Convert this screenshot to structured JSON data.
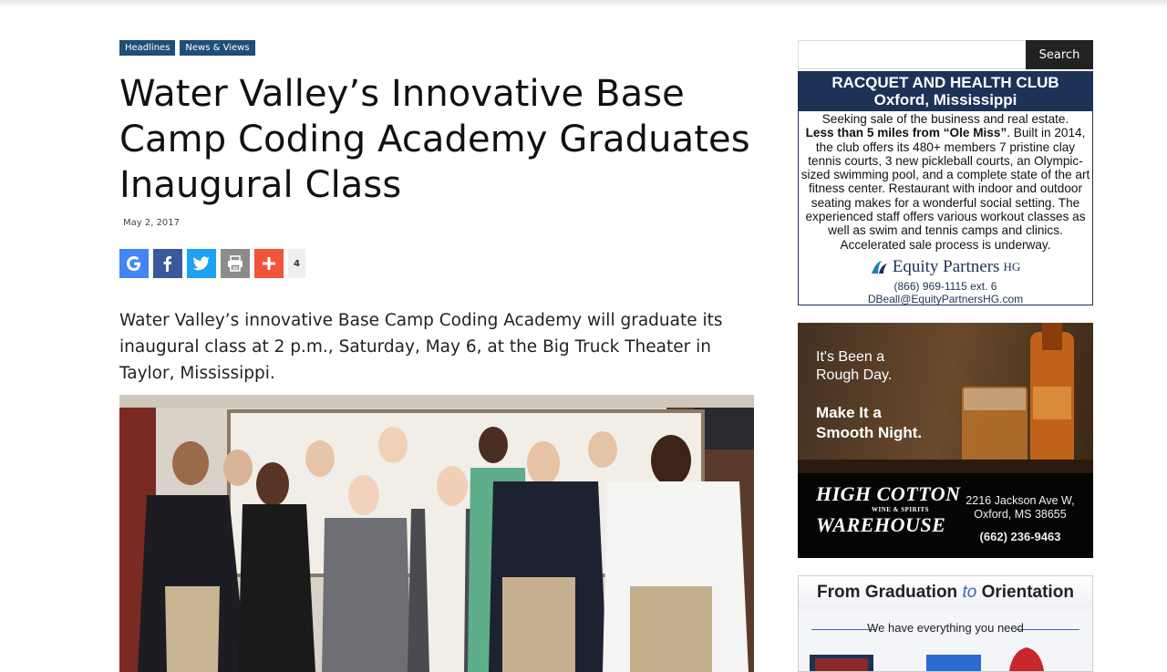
{
  "categories": [
    "Headlines",
    "News & Views"
  ],
  "article": {
    "title": "Water Valley’s Innovative Base Camp Coding Academy Graduates Inaugural Class",
    "date": "May 2, 2017",
    "share_count": "4",
    "lede": "Water Valley’s innovative Base Camp Coding Academy will graduate its inaugural class at 2 p.m., Saturday, May 6, at the Big Truck Theater in Taylor, Mississippi."
  },
  "share_buttons": [
    {
      "icon": "google-icon",
      "color": "#4285f4"
    },
    {
      "icon": "facebook-icon",
      "color": "#3b5998"
    },
    {
      "icon": "twitter-icon",
      "color": "#1da1f2"
    },
    {
      "icon": "print-icon",
      "color": "#8c8c8c"
    },
    {
      "icon": "plus-icon",
      "color": "#f0553b"
    }
  ],
  "search": {
    "placeholder": "",
    "button_label": "Search"
  },
  "ad_racquet": {
    "title_line1": "RACQUET AND HEALTH CLUB",
    "title_line2": "Oxford, Mississippi",
    "body_line1": "Seeking sale of the business and real estate.",
    "body_bold": "Less than 5 miles from “Ole Miss”",
    "body_rest": ".  Built in 2014, the club offers its 480+ members 7 pristine clay tennis courts, 3 new pickleball courts, an Olympic-sized swimming pool, and a complete state of the art fitness center.  Restaurant with indoor and outdoor seating makes for a wonderful social setting.  The experienced staff offers various workout classes as well as swim and tennis camps and clinics.  Accelerated sale process is underway.",
    "logo_name": "Equity Partners",
    "logo_suffix": "HG",
    "phone": "(866) 969-1115 ext. 6",
    "email": "DBeall@EquityPartnersHG.com"
  },
  "ad_cotton": {
    "line1": "It's Been a",
    "line2": "Rough Day.",
    "line3": "Make It a",
    "line4": "Smooth Night.",
    "brand1": "HIGH COTTON",
    "brand2": "WAREHOUSE",
    "brand_tag": "WINE & SPIRITS",
    "addr1": "2216 Jackson Ave W,",
    "addr2": "Oxford, MS 38655",
    "phone": "(662) 236-9463"
  },
  "ad_graduation": {
    "title_a": "From Graduation ",
    "title_b": "to",
    "title_c": " Orientation",
    "subtitle": "We have everything you need"
  }
}
